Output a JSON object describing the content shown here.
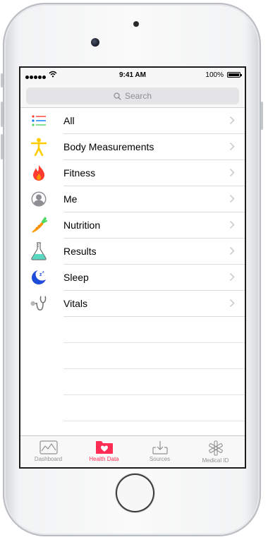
{
  "status_bar": {
    "time": "9:41 AM",
    "battery": "100%"
  },
  "search": {
    "placeholder": "Search"
  },
  "categories": [
    {
      "label": "All",
      "icon": "list-icon"
    },
    {
      "label": "Body Measurements",
      "icon": "body-figure-icon"
    },
    {
      "label": "Fitness",
      "icon": "flame-icon"
    },
    {
      "label": "Me",
      "icon": "person-silhouette-icon"
    },
    {
      "label": "Nutrition",
      "icon": "carrot-icon"
    },
    {
      "label": "Results",
      "icon": "flask-icon"
    },
    {
      "label": "Sleep",
      "icon": "moon-icon"
    },
    {
      "label": "Vitals",
      "icon": "stethoscope-icon"
    }
  ],
  "tabbar": {
    "tabs": [
      {
        "label": "Dashboard",
        "icon": "dashboard-graph-icon"
      },
      {
        "label": "Health Data",
        "icon": "health-data-folder-icon"
      },
      {
        "label": "Sources",
        "icon": "sources-download-icon"
      },
      {
        "label": "Medical ID",
        "icon": "medical-id-star-icon"
      }
    ],
    "active_index": 1
  },
  "colors": {
    "accent": "#ff2d55",
    "chevron": "#c7c7cc",
    "inactive_tab": "#929292"
  }
}
